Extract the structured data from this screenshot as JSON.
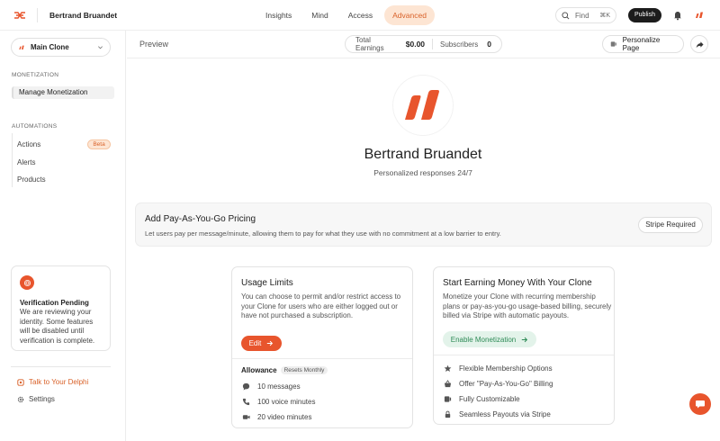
{
  "topbar": {
    "owner_name": "Bertrand Bruandet",
    "nav": [
      {
        "label": "Insights",
        "active": false
      },
      {
        "label": "Mind",
        "active": false
      },
      {
        "label": "Access",
        "active": false
      },
      {
        "label": "Advanced",
        "active": true
      }
    ],
    "find_label": "Find",
    "find_shortcut": "⌘K",
    "publish_label": "Publish",
    "icons": {
      "logo": "delphi-logo-icon",
      "bell": "bell-icon",
      "avatar": "clone-avatar-icon"
    }
  },
  "sidebar": {
    "clone_select": "Main Clone",
    "monetization_title": "MONETIZATION",
    "monetization_items": [
      "Manage Monetization"
    ],
    "automations_title": "AUTOMATIONS",
    "automation_items": [
      "Actions",
      "Alerts",
      "Products"
    ],
    "beta_badge": "Beta",
    "verification": {
      "title": "Verification Pending",
      "text": "We are reviewing your identity. Some features will be disabled until verification is complete."
    },
    "talk_link": "Talk to Your Delphi",
    "settings_link": "Settings"
  },
  "header": {
    "preview_label": "Preview",
    "total_earnings_label": "Total Earnings",
    "total_earnings_value": "$0.00",
    "subscribers_label": "Subscribers",
    "subscribers_value": "0",
    "personalize_label": "Personalize Page"
  },
  "profile": {
    "name": "Bertrand Bruandet",
    "tagline": "Personalized responses 24/7"
  },
  "payg": {
    "title": "Add Pay-As-You-Go Pricing",
    "description": "Let users pay per message/minute, allowing them to pay for what they use with no commitment at a low barrier to entry.",
    "button": "Stripe Required"
  },
  "usage_card": {
    "title": "Usage Limits",
    "description": "You can choose to permit and/or restrict access to your Clone for users who are either logged out or have not purchased a subscription.",
    "edit_label": "Edit",
    "allowance_label": "Allowance",
    "resets_label": "Resets Monthly",
    "items": [
      "10 messages",
      "100 voice minutes",
      "20 video minutes"
    ]
  },
  "earn_card": {
    "title": "Start Earning Money With Your Clone",
    "description": "Monetize your Clone with recurring membership plans or pay-as-you-go usage-based billing, securely billed via Stripe with automatic payouts.",
    "enable_label": "Enable Monetization",
    "features": [
      "Flexible Membership Options",
      "Offer \"Pay-As-You-Go\" Billing",
      "Fully Customizable",
      "Seamless Payouts via Stripe"
    ]
  },
  "colors": {
    "accent": "#e8552d",
    "accent_soft": "#fde5d3",
    "green": "#2e8b57"
  }
}
